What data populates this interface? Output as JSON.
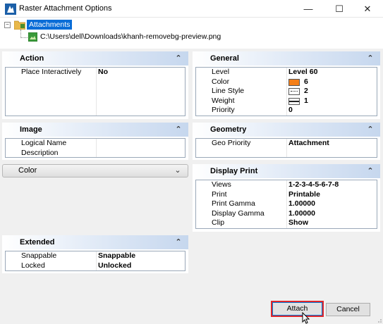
{
  "window": {
    "title": "Raster Attachment Options",
    "minimize_glyph": "—",
    "maximize_glyph": "☐",
    "close_glyph": "✕"
  },
  "tree": {
    "root_label": "Attachments",
    "file_path": "C:\\Users\\dell\\Downloads\\khanh-removebg-preview.png"
  },
  "action": {
    "title": "Action",
    "rows": [
      {
        "key": "Place Interactively",
        "value": "No"
      }
    ]
  },
  "image": {
    "title": "Image",
    "rows": [
      {
        "key": "Logical Name",
        "value": ""
      },
      {
        "key": "Description",
        "value": ""
      }
    ]
  },
  "color": {
    "title": "Color"
  },
  "extended": {
    "title": "Extended",
    "rows": [
      {
        "key": "Snappable",
        "value": "Snappable"
      },
      {
        "key": "Locked",
        "value": "Unlocked"
      }
    ]
  },
  "general": {
    "title": "General",
    "rows": [
      {
        "key": "Level",
        "value": "Level 60"
      },
      {
        "key": "Color",
        "value": "6",
        "swatch": "#f57f17"
      },
      {
        "key": "Line Style",
        "value": "2"
      },
      {
        "key": "Weight",
        "value": "1"
      },
      {
        "key": "Priority",
        "value": "0"
      }
    ]
  },
  "geometry": {
    "title": "Geometry",
    "rows": [
      {
        "key": "Geo Priority",
        "value": "Attachment"
      }
    ]
  },
  "display_print": {
    "title": "Display Print",
    "rows": [
      {
        "key": "Views",
        "value": "1-2-3-4-5-6-7-8"
      },
      {
        "key": "Print",
        "value": "Printable"
      },
      {
        "key": "Print Gamma",
        "value": "1.00000"
      },
      {
        "key": "Display Gamma",
        "value": "1.00000"
      },
      {
        "key": "Clip",
        "value": "Show"
      }
    ]
  },
  "buttons": {
    "attach": "Attach",
    "cancel": "Cancel"
  },
  "icons": {
    "collapse": "chevron-up-icon",
    "expand": "chevron-down-icon",
    "tree_toggle": "minus-icon"
  },
  "colors": {
    "accent_selection": "#0a6dd7",
    "highlight_box": "#e0262a",
    "header_gradient": "#c6d7ee"
  }
}
